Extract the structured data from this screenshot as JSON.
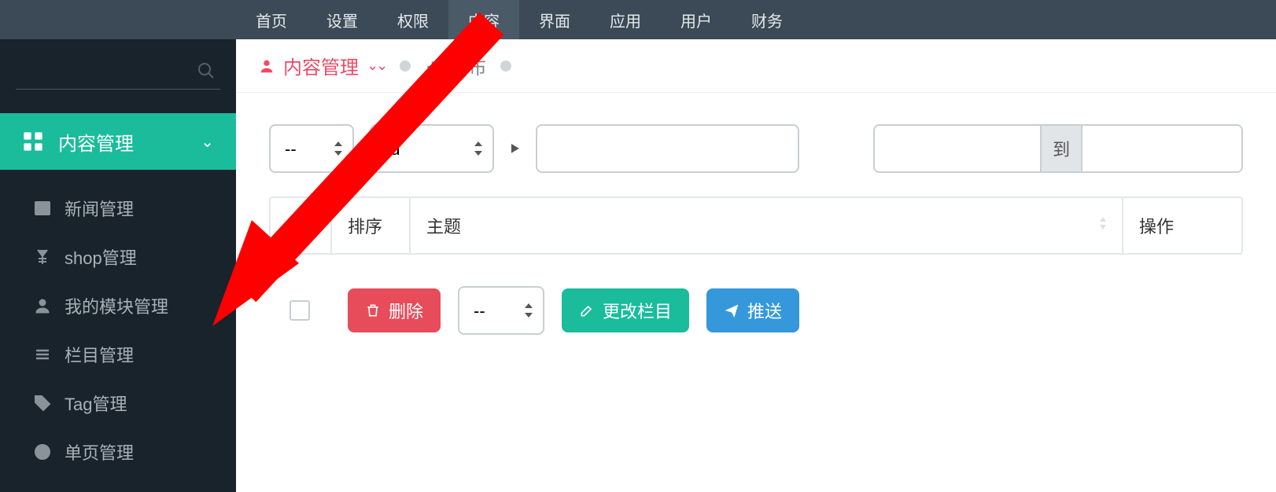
{
  "topnav": {
    "items": [
      "首页",
      "设置",
      "权限",
      "内容",
      "界面",
      "应用",
      "用户",
      "财务"
    ],
    "active_index": 3
  },
  "sidebar": {
    "search_placeholder": "",
    "category_label": "内容管理",
    "items": [
      {
        "label": "新闻管理",
        "icon": "table-icon"
      },
      {
        "label": "shop管理",
        "icon": "yen-icon"
      },
      {
        "label": "我的模块管理",
        "icon": "user-icon"
      },
      {
        "label": "栏目管理",
        "icon": "list-icon"
      },
      {
        "label": "Tag管理",
        "icon": "tag-icon"
      },
      {
        "label": "单页管理",
        "icon": "page-icon"
      }
    ]
  },
  "crumb": {
    "main": "内容管理",
    "publish": "发布"
  },
  "filters": {
    "select1": "--",
    "select2": "Id",
    "input_value": "",
    "range_from": "",
    "range_sep": "到",
    "range_to": ""
  },
  "table": {
    "col_sort": "排序",
    "col_subject": "主题",
    "col_action": "操作"
  },
  "actions": {
    "delete": "删除",
    "select_action": "--",
    "change_column": "更改栏目",
    "push": "推送"
  },
  "colors": {
    "accent": "#1abc9c",
    "danger": "#e74c5a",
    "blue": "#3498db",
    "crumb": "#ec4a66"
  }
}
